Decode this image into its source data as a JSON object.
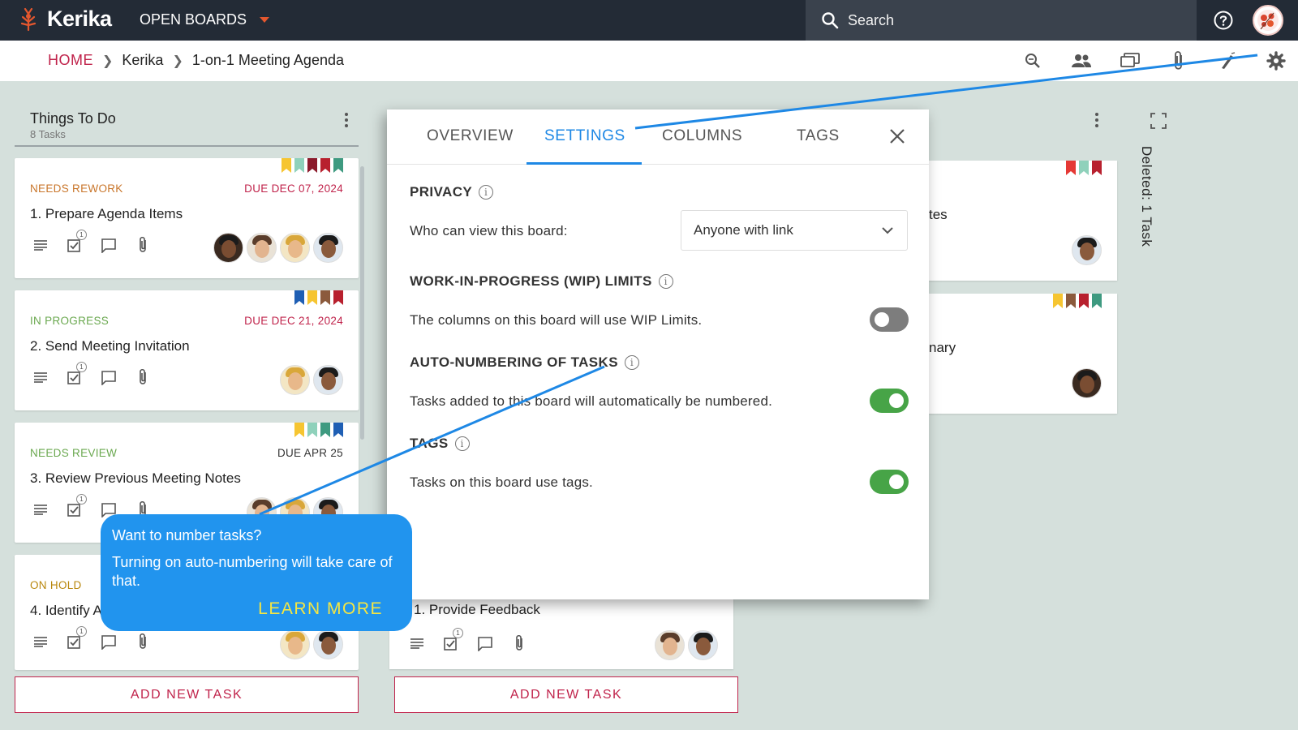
{
  "app": {
    "name": "Kerika",
    "boards_menu": "OPEN BOARDS",
    "search_placeholder": "Search"
  },
  "breadcrumb": {
    "home": "HOME",
    "items": [
      "Kerika",
      "1-on-1 Meeting Agenda"
    ]
  },
  "toolbar_icons": [
    "zoom-icon",
    "team-icon",
    "chat-icon",
    "attachment-icon",
    "highlight-icon",
    "settings-icon"
  ],
  "column": {
    "title": "Things To Do",
    "count": "8 Tasks",
    "add_task": "ADD NEW TASK"
  },
  "cards": [
    {
      "status": "NEEDS REWORK",
      "status_color": "#c9762b",
      "due": "DUE DEC 07, 2024",
      "due_color": "#c0234b",
      "title": "1. Prepare Agenda Items",
      "checklist_count": "1",
      "flags": [
        "#f6c531",
        "#8fd1bb",
        "#8b1a2b",
        "#b8202e",
        "#3e9a80"
      ],
      "avatars": 4
    },
    {
      "status": "IN PROGRESS",
      "status_color": "#6aa84f",
      "due": "DUE DEC 21, 2024",
      "due_color": "#c0234b",
      "title": "2. Send Meeting Invitation",
      "checklist_count": "1",
      "flags": [
        "#1f5fb4",
        "#f6c531",
        "#8b5a3c",
        "#b8202e"
      ],
      "avatars": 2
    },
    {
      "status": "NEEDS REVIEW",
      "status_color": "#6aa84f",
      "due": "DUE APR 25",
      "due_color": "#333333",
      "title": "3. Review Previous Meeting Notes",
      "checklist_count": "1",
      "flags": [
        "#f6c531",
        "#8fd1bb",
        "#3e9a80",
        "#1f5fb4"
      ],
      "avatars": 3
    },
    {
      "status": "ON HOLD",
      "status_color": "#b8860b",
      "due": "",
      "due_color": "#333333",
      "title": "4. Identify A",
      "checklist_count": "1",
      "flags": [],
      "avatars": 2
    }
  ],
  "middle_column": {
    "card_title": "1. Provide Feedback",
    "checklist_count": "1",
    "add_task": "ADD NEW TASK"
  },
  "right_column": {
    "card1_partial": "tes",
    "card1_flags": [
      "#e53935",
      "#8fd1bb",
      "#b8202e"
    ],
    "card2_partial": "nary",
    "card2_flags": [
      "#f6c531",
      "#8b5a3c",
      "#b8202e",
      "#3e9a80"
    ],
    "deleted": "Deleted: 1 Task"
  },
  "dialog": {
    "tabs": [
      "OVERVIEW",
      "SETTINGS",
      "COLUMNS",
      "TAGS"
    ],
    "active_tab": "SETTINGS",
    "privacy": {
      "heading": "PRIVACY",
      "label": "Who can view this board:",
      "value": "Anyone with link"
    },
    "wip": {
      "heading": "WORK-IN-PROGRESS (WIP) LIMITS",
      "label": "The columns on this board will use WIP Limits.",
      "enabled": false
    },
    "autonum": {
      "heading": "AUTO-NUMBERING OF TASKS",
      "label": "Tasks added to this board will automatically be numbered.",
      "enabled": true
    },
    "tags": {
      "heading": "TAGS",
      "label": "Tasks on this board use tags.",
      "enabled": true
    }
  },
  "tooltip": {
    "question": "Want to number tasks?",
    "body": "Turning on auto-numbering will take care of that.",
    "link": "LEARN MORE"
  },
  "colors": {
    "accent": "#1e88e5",
    "brand": "#c0234b",
    "topbar": "#232b36",
    "toggle_on": "#47a447",
    "callout": "#2194ee",
    "learn_more": "#f5e642"
  }
}
